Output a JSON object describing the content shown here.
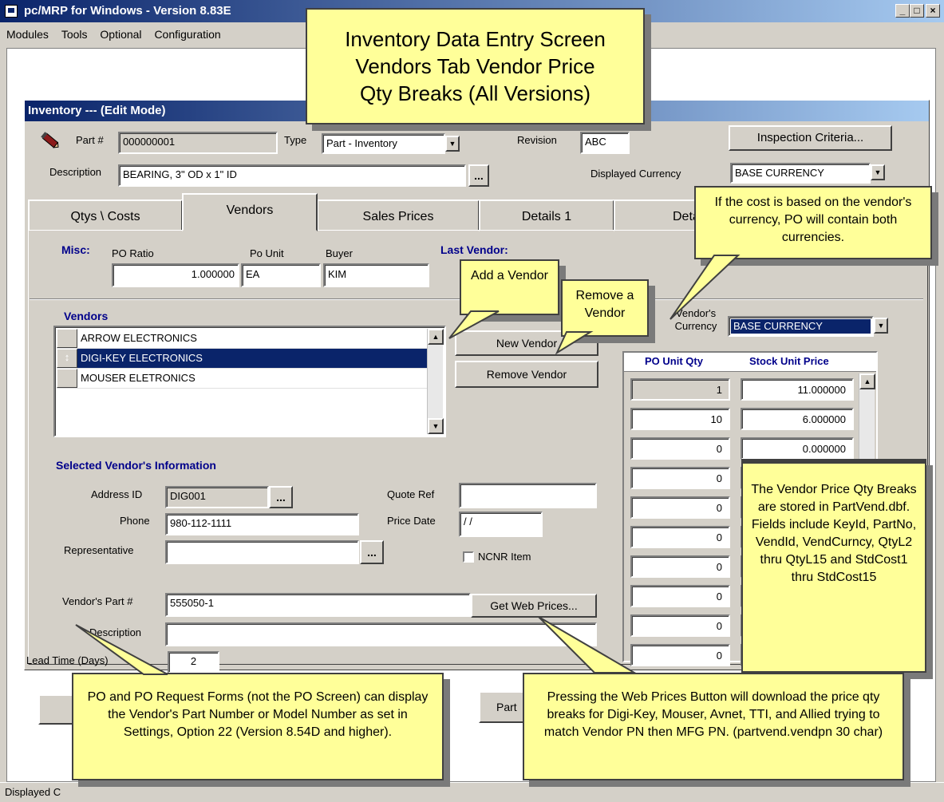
{
  "window": {
    "title": "pc/MRP for Windows - Version 8.83E",
    "min": "_",
    "max": "□",
    "close": "×"
  },
  "menu": [
    "Modules",
    "Tools",
    "Optional",
    "Configuration"
  ],
  "child": {
    "title": "Inventory --- (Edit Mode)"
  },
  "header": {
    "part_label": "Part #",
    "part_value": "000000001",
    "type_label": "Type",
    "type_value": "Part - Inventory",
    "revision_label": "Revision",
    "revision_value": "ABC",
    "inspection_button": "Inspection Criteria...",
    "description_label": "Description",
    "description_value": "BEARING, 3\" OD x 1\" ID",
    "ellipsis": "...",
    "currency_label": "Displayed Currency",
    "currency_value": "BASE CURRENCY"
  },
  "tabs": [
    "Qtys \\ Costs",
    "Vendors",
    "Sales Prices",
    "Details 1",
    "Detail"
  ],
  "misc": {
    "label": "Misc:",
    "po_ratio_label": "PO Ratio",
    "po_ratio_value": "1.000000",
    "po_unit_label": "Po Unit",
    "po_unit_value": "EA",
    "buyer_label": "Buyer",
    "buyer_value": "KIM",
    "last_vendor_label": "Last Vendor:"
  },
  "vendors": {
    "heading": "Vendors",
    "rows": [
      {
        "name": "ARROW ELECTRONICS",
        "marker": ""
      },
      {
        "name": "DIGI-KEY ELECTRONICS",
        "marker": "↕"
      },
      {
        "name": "MOUSER ELETRONICS",
        "marker": ""
      }
    ],
    "new_button": "New Vendor",
    "remove_button": "Remove Vendor",
    "currency_label": "Vendor's Currency",
    "currency_value": "BASE CURRENCY"
  },
  "price_grid": {
    "col1": "PO Unit Qty",
    "col2": "Stock Unit Price",
    "rows": [
      {
        "qty": "1",
        "price": "11.000000"
      },
      {
        "qty": "10",
        "price": "6.000000"
      },
      {
        "qty": "0",
        "price": "0.000000"
      },
      {
        "qty": "0",
        "price": ""
      },
      {
        "qty": "0",
        "price": ""
      },
      {
        "qty": "0",
        "price": ""
      },
      {
        "qty": "0",
        "price": ""
      },
      {
        "qty": "0",
        "price": ""
      },
      {
        "qty": "0",
        "price": ""
      },
      {
        "qty": "0",
        "price": ""
      }
    ]
  },
  "selected_vendor": {
    "heading": "Selected Vendor's Information",
    "address_label": "Address ID",
    "address_value": "DIG001",
    "phone_label": "Phone",
    "phone_value": "980-112-1111",
    "rep_label": "Representative",
    "rep_value": "",
    "quote_label": "Quote Ref",
    "quote_value": "",
    "price_date_label": "Price Date",
    "price_date_value": "/ /",
    "ncnr_label": "NCNR Item",
    "vendor_part_label": "Vendor's Part #",
    "vendor_part_value": "555050-1",
    "web_prices_button": "Get Web Prices...",
    "description_label": "Description",
    "description_value": "",
    "lead_label": "Lead Time (Days)",
    "lead_value": "2"
  },
  "bottom": {
    "part_button": "Part"
  },
  "status": {
    "text": "Displayed C"
  },
  "callouts": {
    "title_line1": "Inventory Data Entry Screen",
    "title_line2": "Vendors Tab Vendor Price",
    "title_line3": "Qty Breaks (All Versions)",
    "add_vendor": "Add a Vendor",
    "remove_vendor": "Remove a Vendor",
    "currency_note": "If the cost is based on the vendor's currency, PO will contain both currencies.",
    "storage_note": "The Vendor Price Qty Breaks are stored in PartVend.dbf.  Fields include KeyId, PartNo, VendId, VendCurncy, QtyL2 thru QtyL15 and StdCost1 thru StdCost15",
    "po_forms_note": "PO and PO Request Forms (not the PO Screen) can display the Vendor's Part Number or Model Number as set in Settings, Option 22 (Version 8.54D and higher).",
    "web_prices_note": "Pressing the Web Prices Button will download the price qty breaks for Digi-Key, Mouser, Avnet, TTI, and Allied trying to match Vendor PN then MFG PN.  (partvend.vendpn 30 char)"
  }
}
